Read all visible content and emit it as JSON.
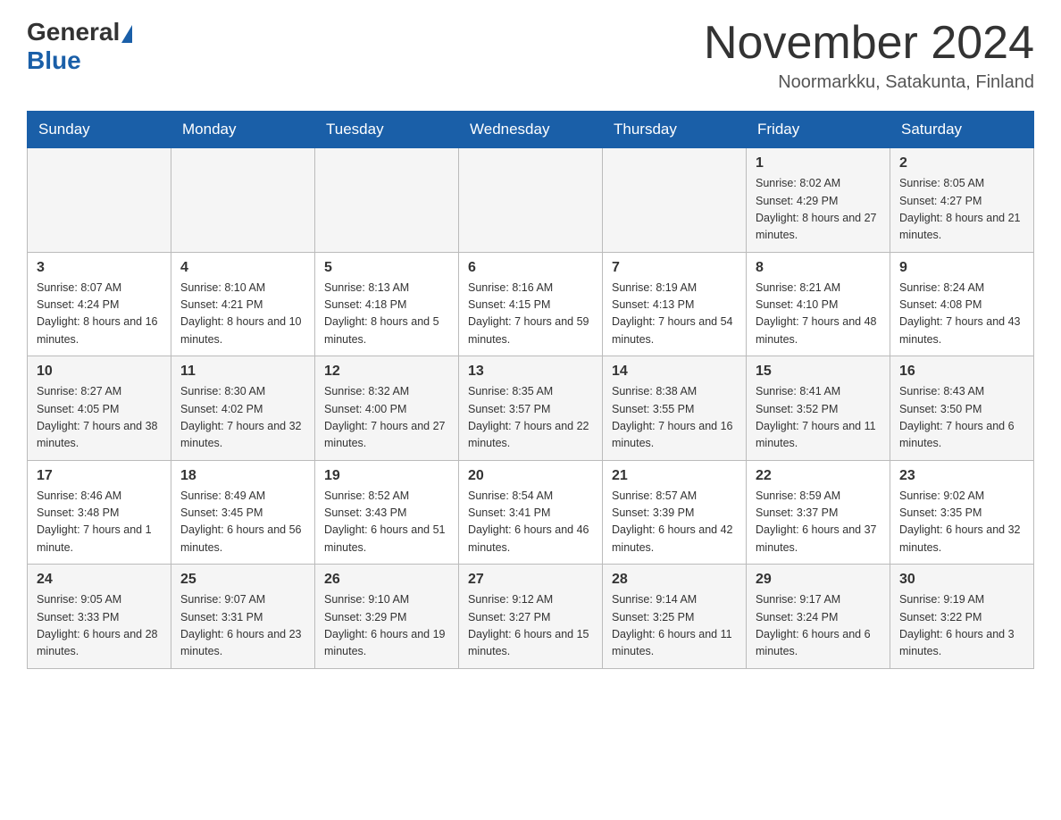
{
  "header": {
    "logo": {
      "general": "General",
      "blue": "Blue"
    },
    "title": "November 2024",
    "location": "Noormarkku, Satakunta, Finland"
  },
  "days_of_week": [
    "Sunday",
    "Monday",
    "Tuesday",
    "Wednesday",
    "Thursday",
    "Friday",
    "Saturday"
  ],
  "weeks": [
    {
      "days": [
        {
          "number": "",
          "info": ""
        },
        {
          "number": "",
          "info": ""
        },
        {
          "number": "",
          "info": ""
        },
        {
          "number": "",
          "info": ""
        },
        {
          "number": "",
          "info": ""
        },
        {
          "number": "1",
          "info": "Sunrise: 8:02 AM\nSunset: 4:29 PM\nDaylight: 8 hours and 27 minutes."
        },
        {
          "number": "2",
          "info": "Sunrise: 8:05 AM\nSunset: 4:27 PM\nDaylight: 8 hours and 21 minutes."
        }
      ]
    },
    {
      "days": [
        {
          "number": "3",
          "info": "Sunrise: 8:07 AM\nSunset: 4:24 PM\nDaylight: 8 hours and 16 minutes."
        },
        {
          "number": "4",
          "info": "Sunrise: 8:10 AM\nSunset: 4:21 PM\nDaylight: 8 hours and 10 minutes."
        },
        {
          "number": "5",
          "info": "Sunrise: 8:13 AM\nSunset: 4:18 PM\nDaylight: 8 hours and 5 minutes."
        },
        {
          "number": "6",
          "info": "Sunrise: 8:16 AM\nSunset: 4:15 PM\nDaylight: 7 hours and 59 minutes."
        },
        {
          "number": "7",
          "info": "Sunrise: 8:19 AM\nSunset: 4:13 PM\nDaylight: 7 hours and 54 minutes."
        },
        {
          "number": "8",
          "info": "Sunrise: 8:21 AM\nSunset: 4:10 PM\nDaylight: 7 hours and 48 minutes."
        },
        {
          "number": "9",
          "info": "Sunrise: 8:24 AM\nSunset: 4:08 PM\nDaylight: 7 hours and 43 minutes."
        }
      ]
    },
    {
      "days": [
        {
          "number": "10",
          "info": "Sunrise: 8:27 AM\nSunset: 4:05 PM\nDaylight: 7 hours and 38 minutes."
        },
        {
          "number": "11",
          "info": "Sunrise: 8:30 AM\nSunset: 4:02 PM\nDaylight: 7 hours and 32 minutes."
        },
        {
          "number": "12",
          "info": "Sunrise: 8:32 AM\nSunset: 4:00 PM\nDaylight: 7 hours and 27 minutes."
        },
        {
          "number": "13",
          "info": "Sunrise: 8:35 AM\nSunset: 3:57 PM\nDaylight: 7 hours and 22 minutes."
        },
        {
          "number": "14",
          "info": "Sunrise: 8:38 AM\nSunset: 3:55 PM\nDaylight: 7 hours and 16 minutes."
        },
        {
          "number": "15",
          "info": "Sunrise: 8:41 AM\nSunset: 3:52 PM\nDaylight: 7 hours and 11 minutes."
        },
        {
          "number": "16",
          "info": "Sunrise: 8:43 AM\nSunset: 3:50 PM\nDaylight: 7 hours and 6 minutes."
        }
      ]
    },
    {
      "days": [
        {
          "number": "17",
          "info": "Sunrise: 8:46 AM\nSunset: 3:48 PM\nDaylight: 7 hours and 1 minute."
        },
        {
          "number": "18",
          "info": "Sunrise: 8:49 AM\nSunset: 3:45 PM\nDaylight: 6 hours and 56 minutes."
        },
        {
          "number": "19",
          "info": "Sunrise: 8:52 AM\nSunset: 3:43 PM\nDaylight: 6 hours and 51 minutes."
        },
        {
          "number": "20",
          "info": "Sunrise: 8:54 AM\nSunset: 3:41 PM\nDaylight: 6 hours and 46 minutes."
        },
        {
          "number": "21",
          "info": "Sunrise: 8:57 AM\nSunset: 3:39 PM\nDaylight: 6 hours and 42 minutes."
        },
        {
          "number": "22",
          "info": "Sunrise: 8:59 AM\nSunset: 3:37 PM\nDaylight: 6 hours and 37 minutes."
        },
        {
          "number": "23",
          "info": "Sunrise: 9:02 AM\nSunset: 3:35 PM\nDaylight: 6 hours and 32 minutes."
        }
      ]
    },
    {
      "days": [
        {
          "number": "24",
          "info": "Sunrise: 9:05 AM\nSunset: 3:33 PM\nDaylight: 6 hours and 28 minutes."
        },
        {
          "number": "25",
          "info": "Sunrise: 9:07 AM\nSunset: 3:31 PM\nDaylight: 6 hours and 23 minutes."
        },
        {
          "number": "26",
          "info": "Sunrise: 9:10 AM\nSunset: 3:29 PM\nDaylight: 6 hours and 19 minutes."
        },
        {
          "number": "27",
          "info": "Sunrise: 9:12 AM\nSunset: 3:27 PM\nDaylight: 6 hours and 15 minutes."
        },
        {
          "number": "28",
          "info": "Sunrise: 9:14 AM\nSunset: 3:25 PM\nDaylight: 6 hours and 11 minutes."
        },
        {
          "number": "29",
          "info": "Sunrise: 9:17 AM\nSunset: 3:24 PM\nDaylight: 6 hours and 6 minutes."
        },
        {
          "number": "30",
          "info": "Sunrise: 9:19 AM\nSunset: 3:22 PM\nDaylight: 6 hours and 3 minutes."
        }
      ]
    }
  ]
}
